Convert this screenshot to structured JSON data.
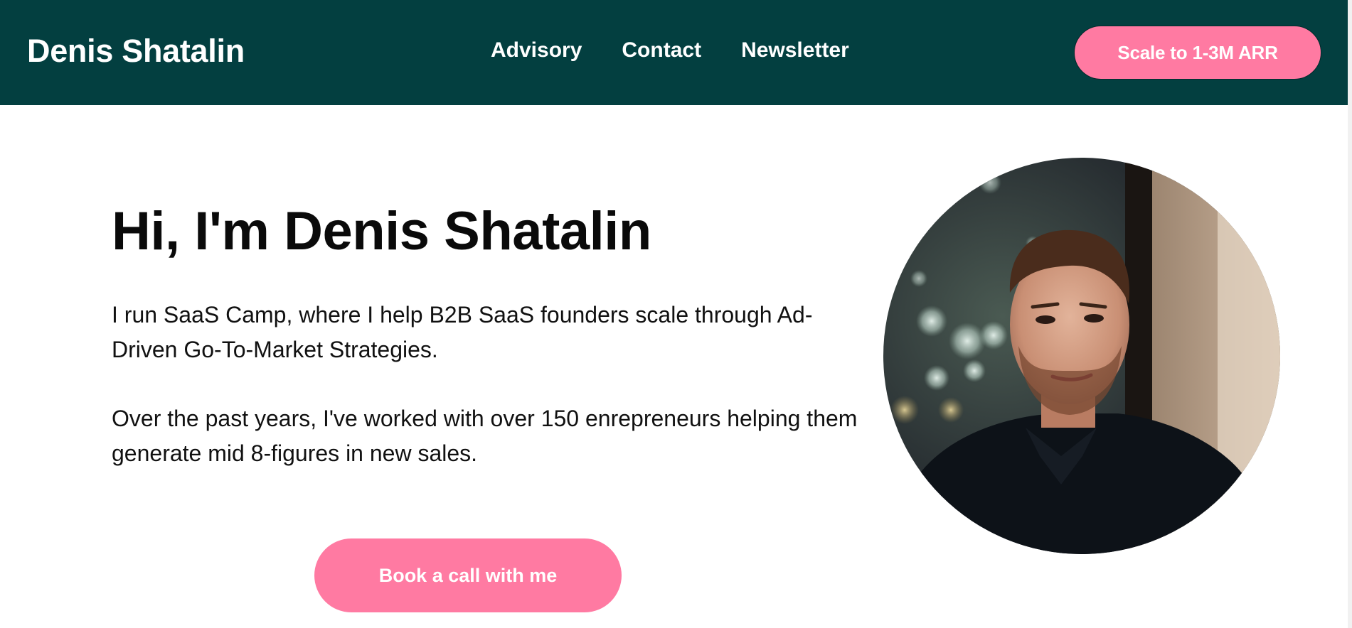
{
  "header": {
    "brand": "Denis Shatalin",
    "nav": [
      {
        "label": "Advisory"
      },
      {
        "label": "Contact"
      },
      {
        "label": "Newsletter"
      }
    ],
    "cta_label": "Scale to 1-3M ARR"
  },
  "hero": {
    "title": "Hi, I'm Denis Shatalin",
    "paragraph_1": "I run SaaS Camp, where I help B2B SaaS founders scale through Ad-Driven Go-To-Market Strategies.",
    "paragraph_2": "Over the past years, I've worked with over 150 enrepreneurs helping them generate mid 8-figures in new sales.",
    "cta_label": "Book a call with me"
  },
  "colors": {
    "header_bg": "#033f40",
    "accent_pink": "#ff7aa2",
    "text": "#0a0a0a"
  }
}
